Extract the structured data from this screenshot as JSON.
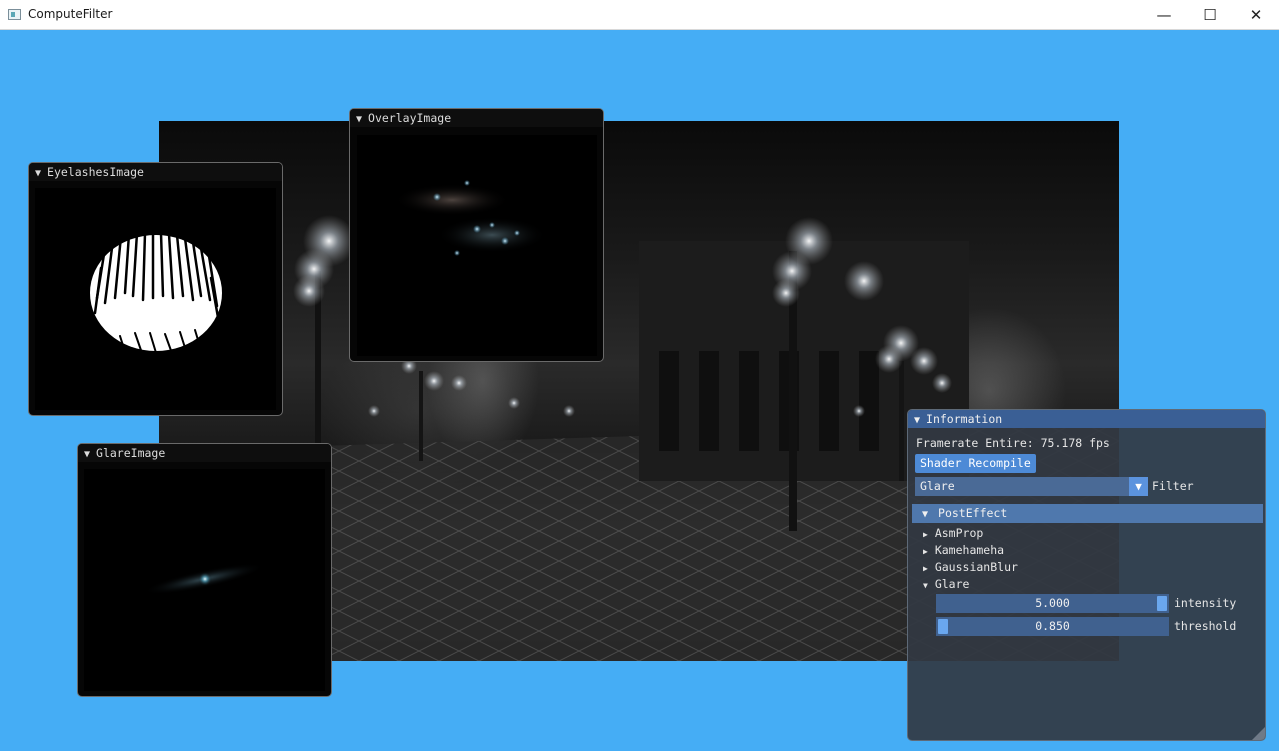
{
  "window": {
    "title": "ComputeFilter",
    "controls": {
      "minimize": "—",
      "maximize": "☐",
      "close": "✕"
    }
  },
  "panels": {
    "eyelashes": {
      "title": "EyelashesImage",
      "collapse_icon": "▼"
    },
    "overlay": {
      "title": "OverlayImage",
      "collapse_icon": "▼"
    },
    "glare": {
      "title": "GlareImage",
      "collapse_icon": "▼"
    }
  },
  "information": {
    "title": "Information",
    "collapse_icon": "▼",
    "framerate": "Framerate Entire: 75.178 fps",
    "recompile_label": "Shader Recompile",
    "filter": {
      "selected": "Glare",
      "label": "Filter",
      "arrow": "▼"
    },
    "posteffect": {
      "label": "PostEffect",
      "icon": "▼"
    },
    "tree": [
      {
        "label": "AsmProp",
        "icon": "▶"
      },
      {
        "label": "Kamehameha",
        "icon": "▶"
      },
      {
        "label": "GaussianBlur",
        "icon": "▶"
      },
      {
        "label": "Glare",
        "icon": "▼"
      }
    ],
    "sliders": [
      {
        "label": "intensity",
        "value": "5.000",
        "fraction": 1.0
      },
      {
        "label": "threshold",
        "value": "0.850",
        "fraction": 0.0
      }
    ]
  },
  "colors": {
    "background": "#45adf5",
    "info_header": "#3a5f95",
    "button": "#4d8ad6",
    "slider_grab": "#6aa7ef"
  }
}
